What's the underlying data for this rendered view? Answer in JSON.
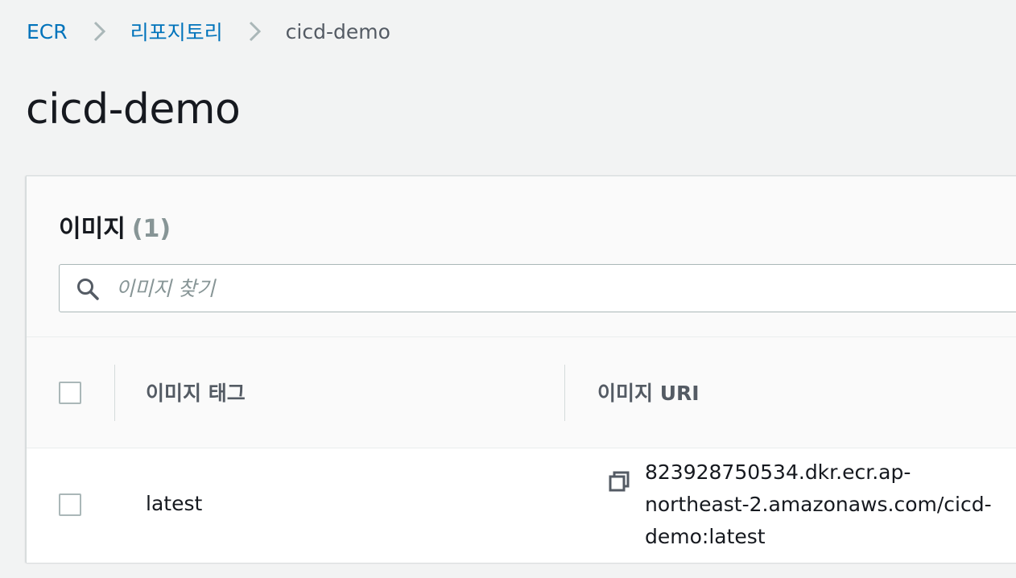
{
  "breadcrumb": {
    "items": [
      {
        "label": "ECR"
      },
      {
        "label": "리포지토리"
      }
    ],
    "current": "cicd-demo"
  },
  "page": {
    "title": "cicd-demo"
  },
  "images_panel": {
    "title": "이미지",
    "count": "(1)",
    "search": {
      "placeholder": "이미지 찾기",
      "value": ""
    },
    "columns": {
      "tag": "이미지 태그",
      "uri": "이미지 URI"
    },
    "rows": [
      {
        "tag": "latest",
        "uri_lines": [
          "823928750534.dkr.ecr.ap-",
          "northeast-2.amazonaws.com/cicd-",
          "demo:latest"
        ]
      }
    ]
  },
  "icons": {
    "breadcrumb_separator": "chevron-right-icon",
    "search": "search-icon",
    "copy": "copy-icon"
  },
  "colors": {
    "link": "#0073bb",
    "page_bg": "#f2f3f3",
    "muted": "#879596",
    "heading": "#16191f"
  }
}
